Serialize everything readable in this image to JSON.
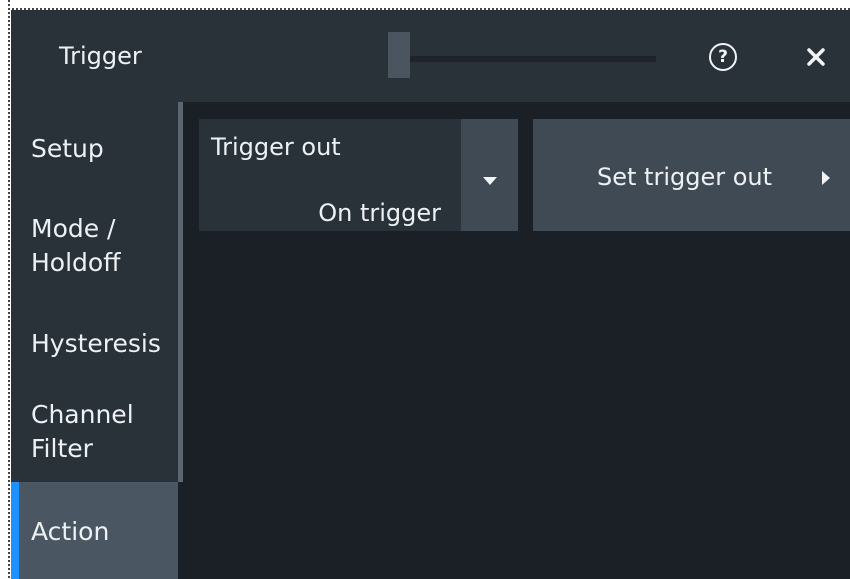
{
  "dialog": {
    "title": "Trigger",
    "help_glyph": "?",
    "help_icon": "question-circle-icon",
    "close_icon": "close-icon"
  },
  "sidebar": {
    "items": [
      {
        "label": "Setup",
        "active": false
      },
      {
        "label": "Mode /\nHoldoff",
        "active": false
      },
      {
        "label": "Hysteresis",
        "active": false
      },
      {
        "label": "Channel\nFilter",
        "active": false
      },
      {
        "label": "Action",
        "active": true
      }
    ]
  },
  "main": {
    "trigger_out": {
      "label": "Trigger out",
      "value": "On trigger",
      "dropdown_icon": "caret-down-icon"
    },
    "set_trigger_out": {
      "label": "Set trigger out",
      "arrow_icon": "caret-right-icon"
    }
  },
  "colors": {
    "accent": "#1e90ff",
    "panel": "#2a3239",
    "background": "#1b2026",
    "button": "#3f4a54",
    "active_item": "#4a5762"
  }
}
